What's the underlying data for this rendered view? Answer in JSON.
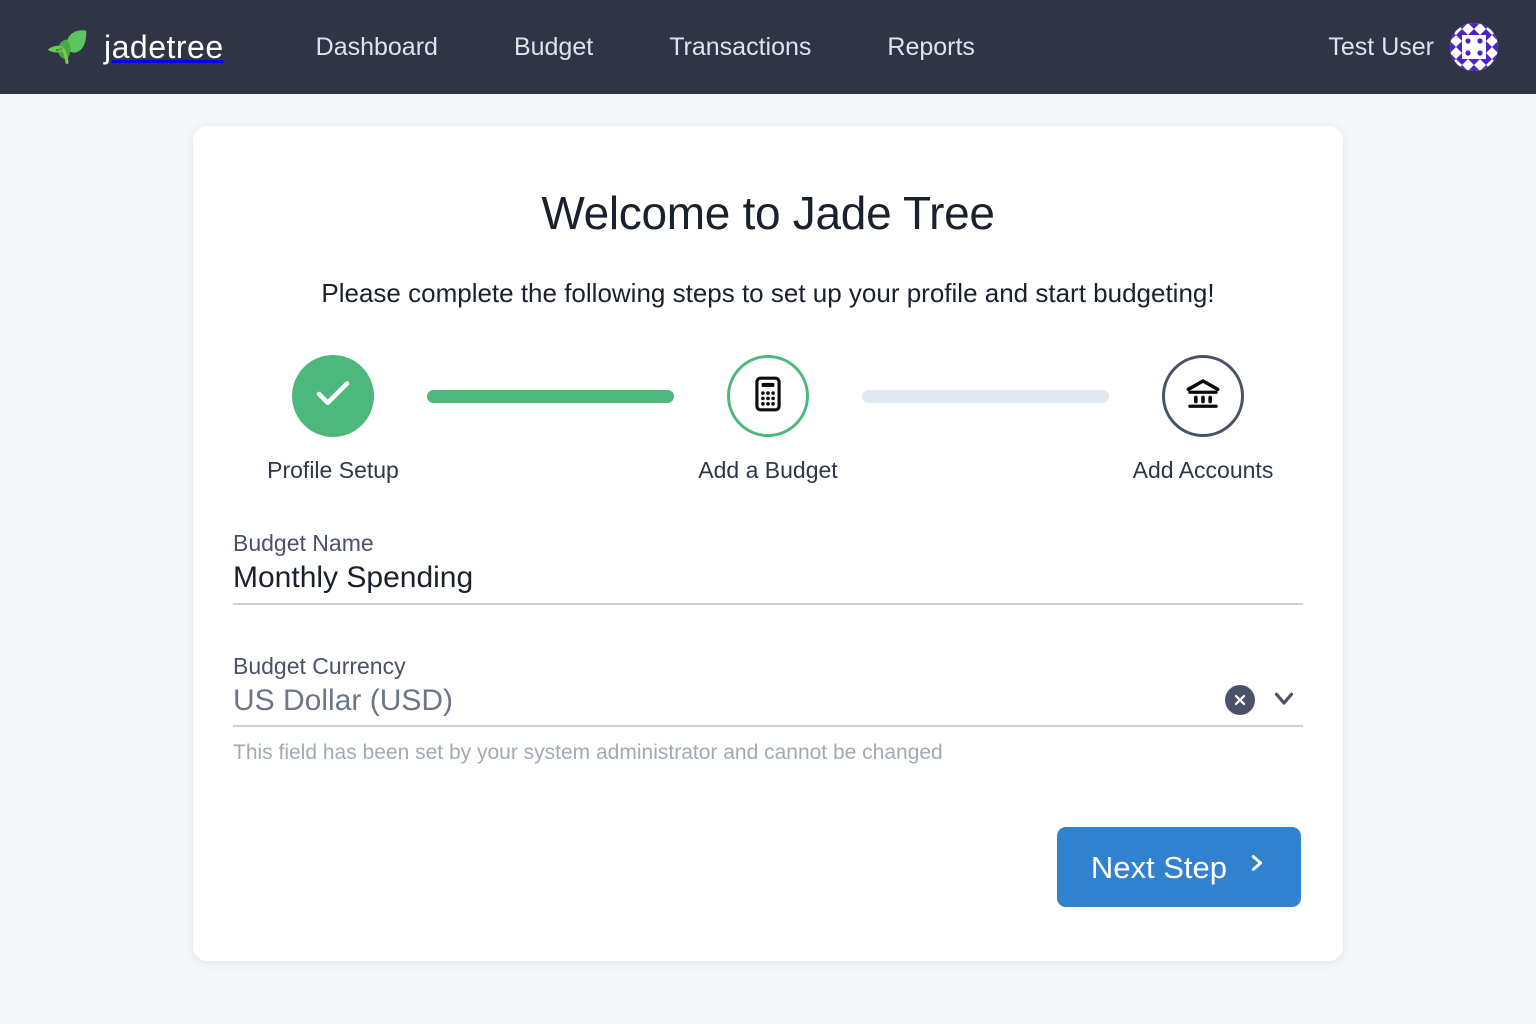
{
  "navbar": {
    "brand": {
      "name": "jadetree",
      "logo_icon": "sprout-leaf-icon"
    },
    "links": [
      {
        "label": "Dashboard"
      },
      {
        "label": "Budget"
      },
      {
        "label": "Transactions"
      },
      {
        "label": "Reports"
      }
    ],
    "user": {
      "name": "Test User",
      "avatar_icon": "identicon-avatar"
    },
    "background_color": "#2f3447",
    "text_color": "#dfe3ec"
  },
  "card": {
    "title": "Welcome to Jade Tree",
    "subtitle": "Please complete the following steps to set up your profile and start budgeting!"
  },
  "stepper": {
    "steps": [
      {
        "label": "Profile Setup",
        "state": "done",
        "icon": "check-icon"
      },
      {
        "label": "Add a Budget",
        "state": "current",
        "icon": "calculator-icon"
      },
      {
        "label": "Add Accounts",
        "state": "pending",
        "icon": "bank-icon"
      }
    ],
    "connectors": [
      {
        "state": "filled"
      },
      {
        "state": "empty"
      }
    ],
    "active_color": "#4cb87c",
    "inactive_color": "#e2e8f0",
    "pending_border_color": "#4a5268"
  },
  "form": {
    "budget_name": {
      "label": "Budget Name",
      "value": "Monthly Spending",
      "placeholder": "Budget Name"
    },
    "budget_currency": {
      "label": "Budget Currency",
      "value": "US Dollar (USD)",
      "placeholder": "Budget Currency",
      "hint": "This field has been set by your system administrator and cannot be changed",
      "clear_icon": "close-circle-icon",
      "dropdown_icon": "chevron-down-icon"
    }
  },
  "actions": {
    "next": {
      "label": "Next Step",
      "icon": "chevron-right-icon",
      "color": "#3182ce"
    }
  }
}
